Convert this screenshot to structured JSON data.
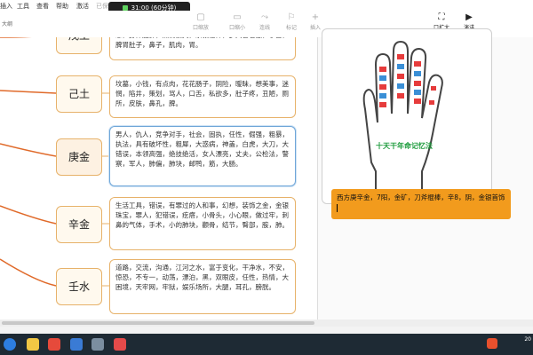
{
  "menu": [
    "插入",
    "工具",
    "查看",
    "帮助",
    "激活",
    "已保"
  ],
  "timer": "31:00 (60分钟)",
  "toolbar": {
    "zoom_label": "口缩放",
    "right1": "口缩小",
    "right2": "连线",
    "right3": "标记",
    "right4": "插入",
    "btn_ok": "口扩大",
    "btn_export": "演讲"
  },
  "breadcrumb": "大纲",
  "nodes": [
    {
      "label": "戊土",
      "text": "忌，身体肥胖，热情豪爽，宗教信仰，多大智若愚，子宫，脾胃肚子，鼻子，肌肉，胃。"
    },
    {
      "label": "己土",
      "text": "坟墓，小钱，有点肉，花花肠子，阴险，暧昧，想美事，迷惘，陷井，策划，骂人，口舌，私欲多，肚子疼，丑陋，厕所，皮肤，鼻孔，脾。"
    },
    {
      "label": "庚金",
      "text": "男人，仇人，竞争对手，社会，固执，任性，倔强，粗暴，执法，具有破坏性，粗犀，大惑病，神盖，白虎，大刀，大错误，本领高强，绝技绝活，女人漂亮，丈夫，公检法，警察，军人，肺偏，肺块，邮鸭，筋，大肠。"
    },
    {
      "label": "辛金",
      "text": "生活工具，错误，有罪过的人和事，幻想，装饰之金，金银珠宝，罪人，犯错误，疙瘩，小骨头，小心眼，做过牢，刺鼻的气体，手术，小的肺块，颧骨，结节，臀部，胺，肺。"
    },
    {
      "label": "壬水",
      "text": "道路，交流，沟通，江河之水，富于变化，干净水，不安，惊恐，不专一，动荡，漂泊，黑，双眼皮，任性，热情，大困境，天牢网，牢狱，娱乐场所，大腿，耳孔，膀胱。"
    }
  ],
  "hand_caption": "十天干年命记忆法",
  "orange_note": "西方庚辛金，7阳，金矿，刀斧棍棒，辛8，阴，金银首饰",
  "clock": "20"
}
